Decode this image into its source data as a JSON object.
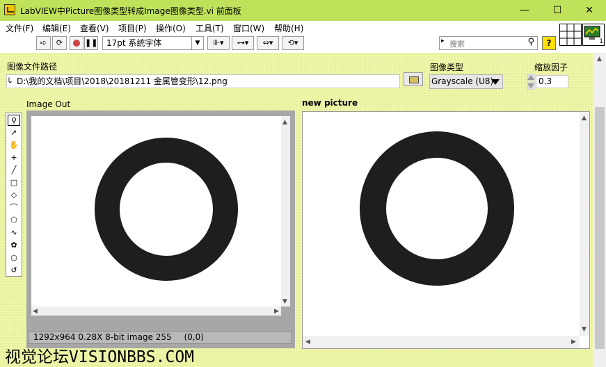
{
  "window": {
    "title": "LabVIEW中Picture图像类型转成Image图像类型.vi 前面板",
    "controls": {
      "minimize": "—",
      "maximize": "☐",
      "close": "✕"
    }
  },
  "menu": [
    "文件(F)",
    "编辑(E)",
    "查看(V)",
    "项目(P)",
    "操作(O)",
    "工具(T)",
    "窗口(W)",
    "帮助(H)"
  ],
  "toolbar": {
    "font": "17pt 系统字体",
    "search_placeholder": "搜索",
    "help": "?"
  },
  "controls": {
    "file_path_label": "图像文件路径",
    "file_path_value": "D:\\我的文档\\项目\\2018\\20181211 金属管变形\\12.png",
    "image_type_label": "图像类型",
    "image_type_value": "Grayscale (U8)",
    "scale_label": "缩放因子",
    "scale_value": "0.3"
  },
  "indicators": {
    "image_out_label": "Image Out",
    "image_status": "1292x964 0.28X 8-bit image 255",
    "image_coord": "(0,0)",
    "new_picture_label": "new picture"
  },
  "watermark": "视觉论坛VISIONBBS.COM",
  "vi_icon_badge": "1"
}
